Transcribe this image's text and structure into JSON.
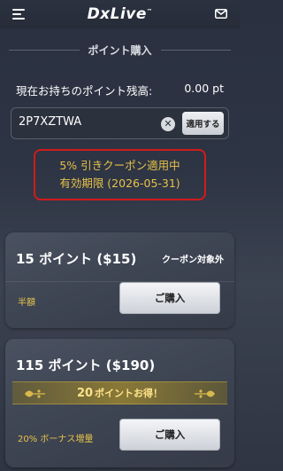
{
  "header": {
    "logo": "DxLive",
    "logo_tm": "™"
  },
  "page": {
    "title": "ポイント購入"
  },
  "balance": {
    "label": "現在お持ちのポイント残高:",
    "value": "0.00 pt"
  },
  "coupon": {
    "input_value": "2P7XZTWA",
    "apply_label": "適用する",
    "clear_symbol": "✕",
    "notice_line1": "5% 引きクーポン適用中",
    "notice_line2": "有効期限 (2026-05-31)"
  },
  "packages": [
    {
      "name": "15 ポイント ($15)",
      "tag": "クーポン対象外",
      "sub_label": "半額",
      "buy_label": "ご購入"
    },
    {
      "name": "115 ポイント ($190)",
      "ribbon_num": "20",
      "ribbon_text": "ポイントお得！",
      "sub_label": "20% ボーナス増量",
      "buy_label": "ご購入"
    }
  ],
  "icons": {
    "menu": "menu-icon",
    "mail": "mail-icon",
    "clear": "clear-icon",
    "ornament": "ornament-icon"
  },
  "colors": {
    "accent_gold": "#e7c24a",
    "alert_red": "#d11b1b",
    "background": "#2d3443"
  }
}
